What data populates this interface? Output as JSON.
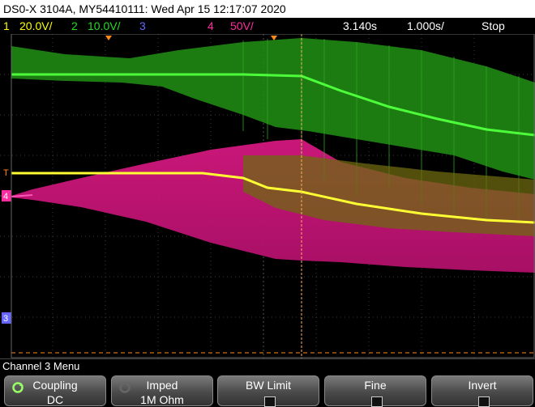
{
  "header": {
    "title": "DS0-X 3104A, MY54410111: Wed Apr 15 12:17:07 2020"
  },
  "status": {
    "ch1_num": "1",
    "ch1_scale": "20.0V/",
    "ch2_num": "2",
    "ch2_scale": "10.0V/",
    "ch3_num": "3",
    "ch4_num": "4",
    "ch4_scale": "50V/",
    "time_offset": "3.140s",
    "time_scale": "1.000s/",
    "run_state": "Stop"
  },
  "colors": {
    "ch1": "#ffff00",
    "ch2": "#22dd22",
    "ch3": "#6666ff",
    "ch4": "#ff2ca0",
    "trigger": "#ff8c1a",
    "grid": "#3a3a3a"
  },
  "markers": {
    "trigger_label": "T",
    "ch4_label": "4",
    "ch3_label": "3"
  },
  "menu": {
    "title": "Channel 3 Menu",
    "softkeys": [
      {
        "label": "Coupling",
        "value": "DC",
        "icon": "rotate-knob-icon"
      },
      {
        "label": "Imped",
        "value": "1M Ohm",
        "icon": "rotate-knob-icon"
      },
      {
        "label": "BW Limit",
        "value": ""
      },
      {
        "label": "Fine",
        "value": ""
      },
      {
        "label": "Invert",
        "value": ""
      }
    ]
  }
}
